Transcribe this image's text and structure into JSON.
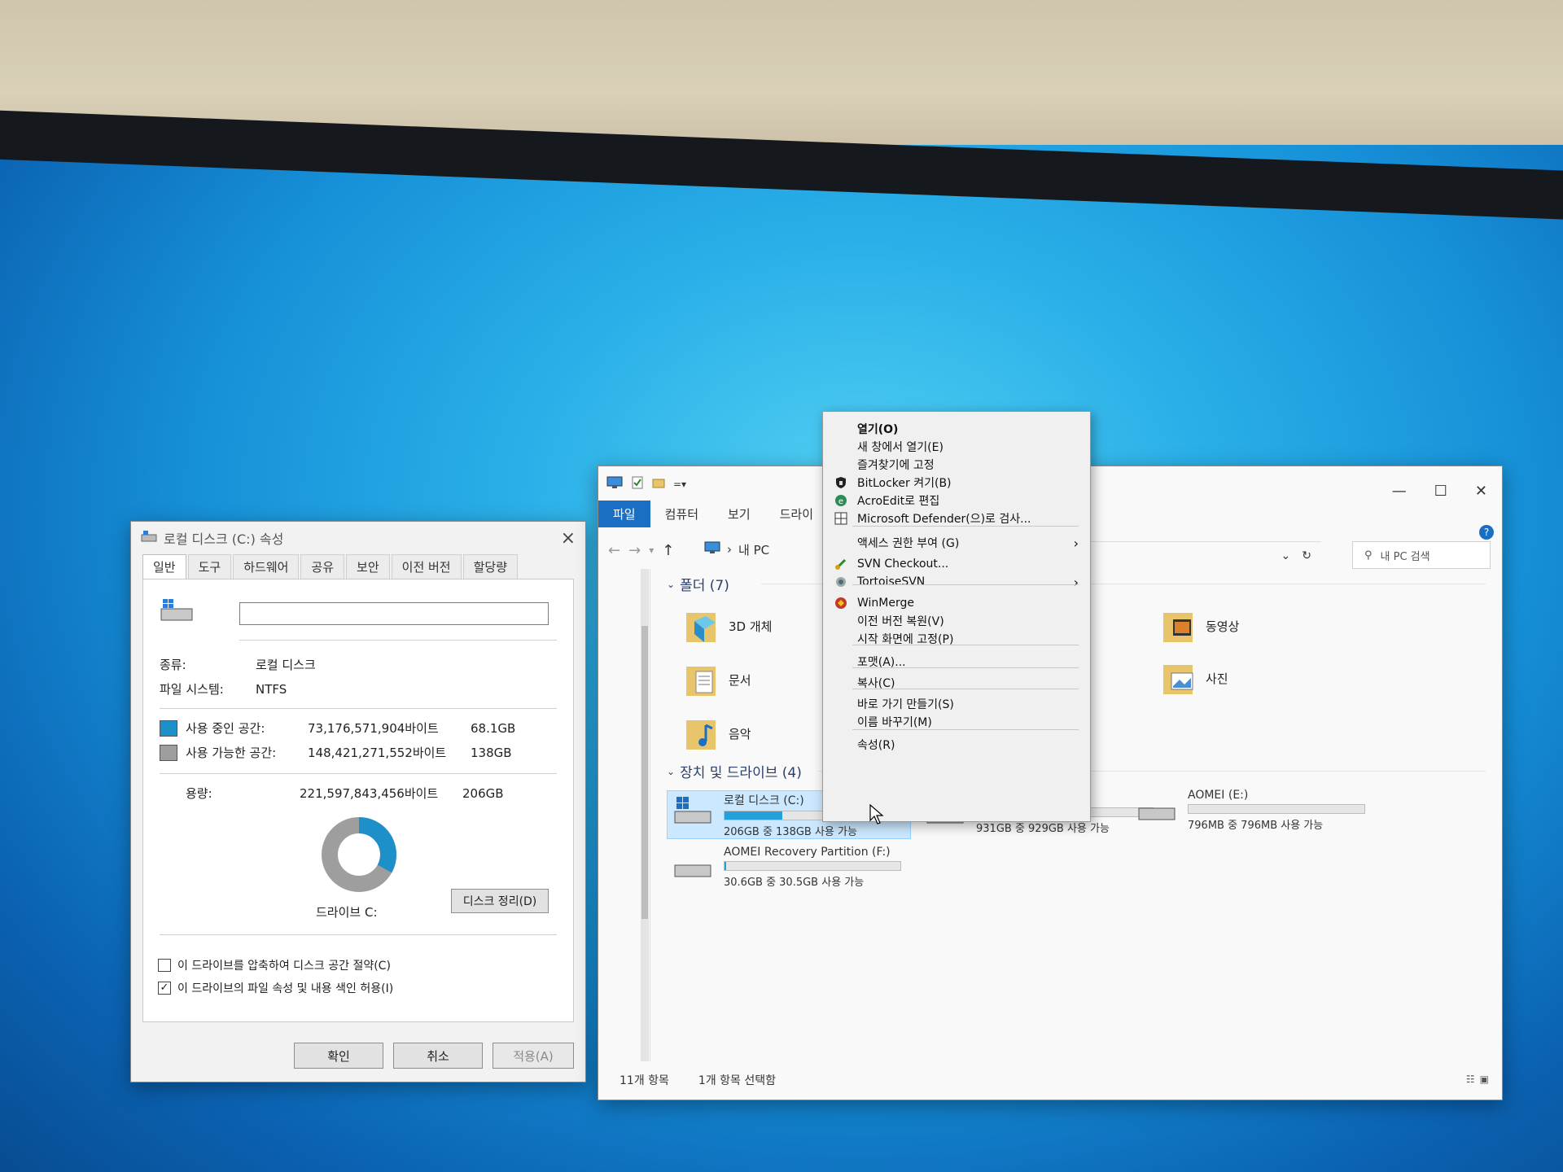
{
  "properties_dialog": {
    "title": "로컬 디스크 (C:) 속성",
    "tabs": [
      "일반",
      "도구",
      "하드웨어",
      "공유",
      "보안",
      "이전 버전",
      "할당량"
    ],
    "name_value": "",
    "type_label": "종류:",
    "type_value": "로컬 디스크",
    "fs_label": "파일 시스템:",
    "fs_value": "NTFS",
    "used_label": "사용 중인 공간:",
    "used_bytes": "73,176,571,904바이트",
    "used_size": "68.1GB",
    "free_label": "사용 가능한 공간:",
    "free_bytes": "148,421,271,552바이트",
    "free_size": "138GB",
    "capacity_label": "용량:",
    "capacity_bytes": "221,597,843,456바이트",
    "capacity_size": "206GB",
    "used_fraction": 0.33,
    "drive_label": "드라이브 C:",
    "cleanup_button": "디스크 정리(D)",
    "compress_option": "이 드라이브를 압축하여 디스크 공간 절약(C)",
    "compress_checked": false,
    "index_option": "이 드라이브의 파일 속성 및 내용 색인 허용(I)",
    "index_checked": true,
    "ok_button": "확인",
    "cancel_button": "취소",
    "apply_button": "적용(A)",
    "colors": {
      "used": "#1d8fc9",
      "free": "#9e9e9e"
    }
  },
  "explorer": {
    "ribbon_tabs": [
      "파일",
      "컴퓨터",
      "보기",
      "드라이"
    ],
    "path": "내 PC",
    "search_placeholder": "내 PC 검색",
    "folders_header": "폴더 (7)",
    "folders": [
      {
        "name": "3D 개체",
        "icon": "3d-objects-folder-icon"
      },
      {
        "name": "문서",
        "icon": "documents-folder-icon"
      },
      {
        "name": "음악",
        "icon": "music-folder-icon"
      },
      {
        "name": "동영상",
        "icon": "videos-folder-icon"
      },
      {
        "name": "사진",
        "icon": "pictures-folder-icon"
      }
    ],
    "devices_header": "장치 및 드라이브 (4)",
    "drives": [
      {
        "name": "로컬 디스크 (C:)",
        "info": "206GB 중 138GB 사용 가능",
        "used_fraction": 0.33
      },
      {
        "name": "AOMEI Recovery Partition (F:)",
        "info": "30.6GB 중 30.5GB 사용 가능",
        "used_fraction": 0.01
      },
      {
        "name": "",
        "info": "931GB 중 929GB 사용 가능",
        "used_fraction": 0.01
      },
      {
        "name": "AOMEI (E:)",
        "info": "796MB 중 796MB 사용 가능",
        "used_fraction": 0.0
      }
    ],
    "status_count": "11개 항목",
    "status_selected": "1개 항목 선택함"
  },
  "context_menu": {
    "items": [
      {
        "label": "열기(O)",
        "bold": true
      },
      {
        "label": "새 창에서 열기(E)"
      },
      {
        "label": "즐겨찾기에 고정"
      },
      {
        "label": "BitLocker 켜기(B)",
        "icon": "shield-icon"
      },
      {
        "label": "AcroEdit로 편집",
        "icon": "acroedit-icon"
      },
      {
        "label": "Microsoft Defender(으)로 검사...",
        "icon": "defender-icon"
      },
      {
        "label": "액세스 권한 부여 (G)",
        "submenu": true
      },
      {
        "label": "SVN Checkout...",
        "icon": "svn-checkout-icon"
      },
      {
        "label": "TortoiseSVN",
        "icon": "tortoisesvn-icon",
        "submenu": true
      },
      {
        "label": "WinMerge",
        "icon": "winmerge-icon"
      },
      {
        "label": "이전 버전 복원(V)"
      },
      {
        "label": "시작 화면에 고정(P)"
      },
      {
        "label": "포맷(A)..."
      },
      {
        "label": "복사(C)"
      },
      {
        "label": "바로 가기 만들기(S)"
      },
      {
        "label": "이름 바꾸기(M)"
      },
      {
        "label": "속성(R)"
      }
    ]
  }
}
